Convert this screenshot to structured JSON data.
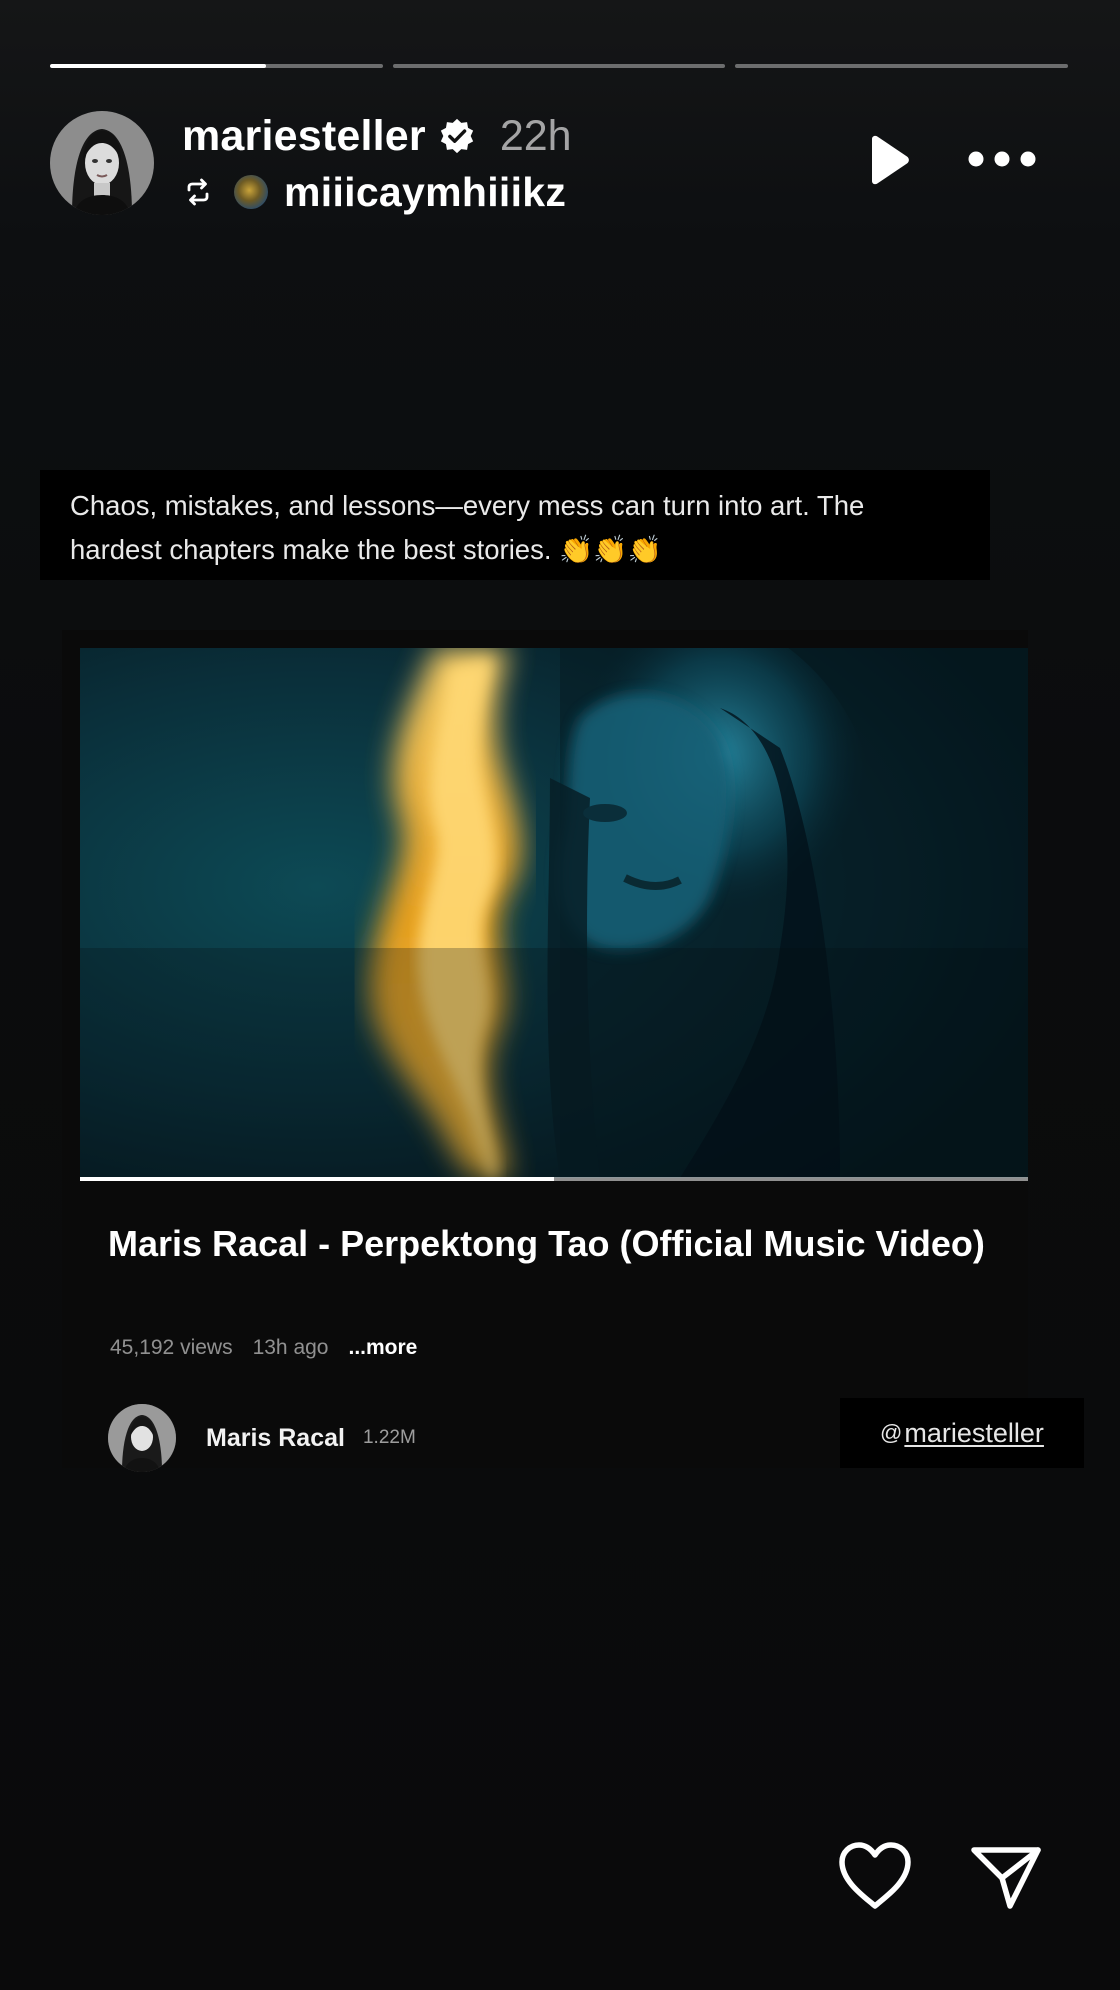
{
  "progress": {
    "segments": [
      {
        "fill": 0.65
      },
      {
        "fill": 0.0
      },
      {
        "fill": 0.0
      }
    ]
  },
  "header": {
    "username": "mariesteller",
    "time_ago": "22h",
    "reposted_from": "miiicaymhiiikz",
    "icons": {
      "verified": "verified-badge-icon",
      "repost": "repost-icon",
      "play": "play-icon",
      "more": "more-options-icon"
    }
  },
  "caption": {
    "line1": "Chaos, mistakes, and lessons—every mess can turn into art. The",
    "line2": "hardest chapters make the best stories. 👏👏👏"
  },
  "video_card": {
    "title": "Maris Racal - Perpektong Tao (Official Music Video)",
    "views": "45,192 views",
    "posted": "13h ago",
    "more_label": "...more",
    "channel_name": "Maris Racal",
    "channel_subscribers": "1.22M",
    "playback_progress": 0.5
  },
  "mention": {
    "at_symbol": "@",
    "handle": "mariesteller"
  },
  "actions": {
    "like_icon": "heart-icon",
    "share_icon": "send-icon"
  },
  "colors": {
    "background": "#0b0c0d",
    "text_primary": "#ffffff",
    "text_secondary": "#9a9a9a",
    "flame": "#f0a020",
    "video_teal": "#0a3a44"
  }
}
